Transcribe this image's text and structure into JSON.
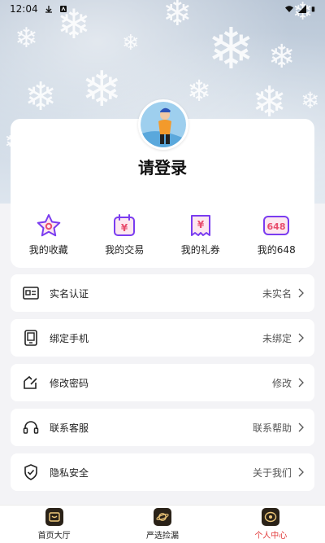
{
  "status_bar": {
    "time": "12:04"
  },
  "profile": {
    "title": "请登录"
  },
  "quick_actions": [
    {
      "label": "我的收藏",
      "icon": "star-icon"
    },
    {
      "label": "我的交易",
      "icon": "yen-calendar-icon"
    },
    {
      "label": "我的礼券",
      "icon": "yen-coupon-icon"
    },
    {
      "label": "我的648",
      "icon": "648-badge-icon",
      "badge": "648"
    }
  ],
  "settings": [
    {
      "label": "实名认证",
      "value": "未实名",
      "icon": "id-card-icon"
    },
    {
      "label": "绑定手机",
      "value": "未绑定",
      "icon": "phone-icon"
    },
    {
      "label": "修改密码",
      "value": "修改",
      "icon": "edit-icon"
    },
    {
      "label": "联系客服",
      "value": "联系帮助",
      "icon": "headset-icon"
    },
    {
      "label": "隐私安全",
      "value": "关于我们",
      "icon": "shield-icon"
    }
  ],
  "tabs": [
    {
      "label": "首页大厅",
      "icon": "home-icon",
      "active": false
    },
    {
      "label": "严选捡漏",
      "icon": "planet-icon",
      "active": false
    },
    {
      "label": "个人中心",
      "icon": "user-center-icon",
      "active": true
    }
  ],
  "colors": {
    "accent": "#7a3cf0",
    "active_tab": "#e23b3b"
  }
}
